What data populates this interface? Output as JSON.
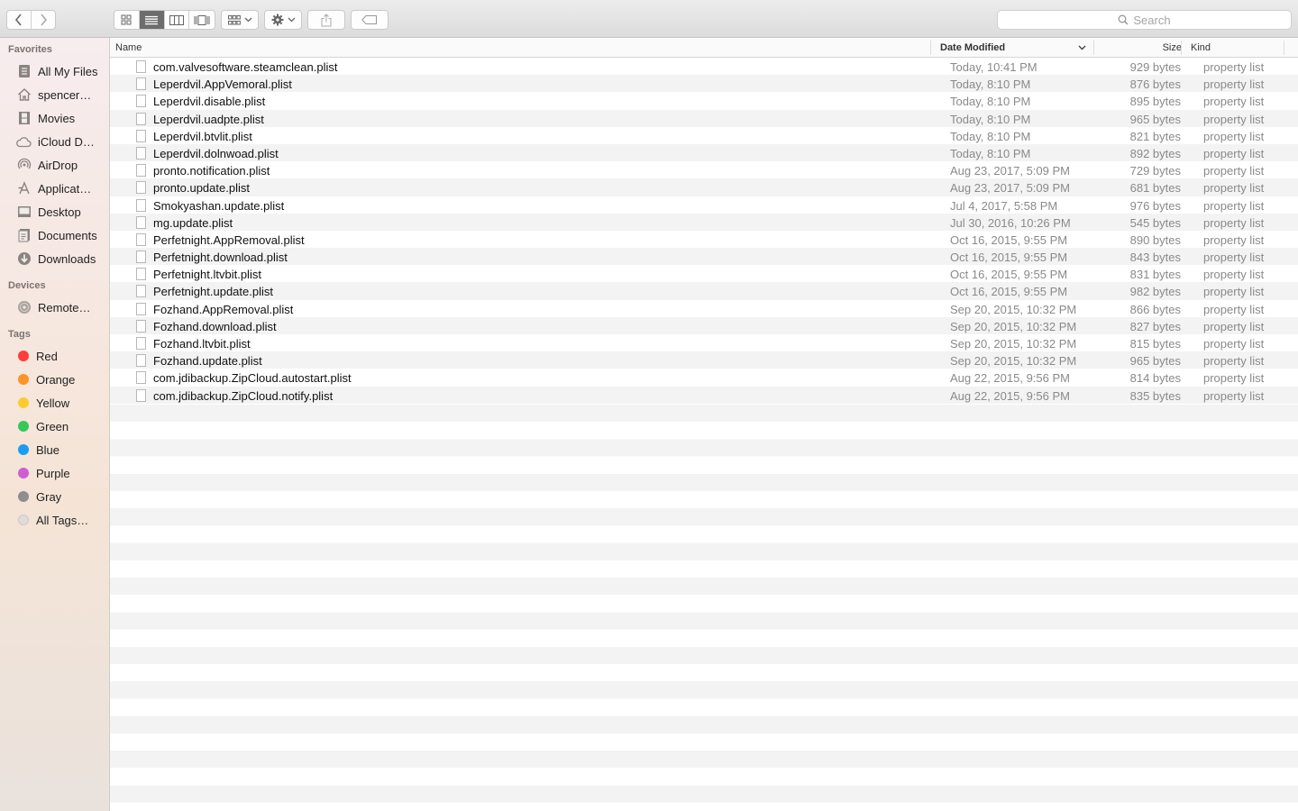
{
  "toolbar": {
    "search_placeholder": "Search",
    "back_icon": "chevron-left-icon",
    "forward_icon": "chevron-right-icon",
    "view_modes": [
      "icon-view-icon",
      "list-view-icon",
      "column-view-icon",
      "coverflow-view-icon"
    ],
    "active_view": "list-view-icon"
  },
  "sidebar": {
    "favorites_header": "Favorites",
    "favorites": [
      {
        "label": "All My Files",
        "icon": "all-files-icon"
      },
      {
        "label": "spencer…",
        "icon": "home-icon"
      },
      {
        "label": "Movies",
        "icon": "movies-icon"
      },
      {
        "label": "iCloud D…",
        "icon": "cloud-icon"
      },
      {
        "label": "AirDrop",
        "icon": "airdrop-icon"
      },
      {
        "label": "Applicat…",
        "icon": "applications-icon"
      },
      {
        "label": "Desktop",
        "icon": "desktop-icon"
      },
      {
        "label": "Documents",
        "icon": "documents-icon"
      },
      {
        "label": "Downloads",
        "icon": "downloads-icon"
      }
    ],
    "devices_header": "Devices",
    "devices": [
      {
        "label": "Remote…",
        "icon": "remote-disc-icon"
      }
    ],
    "tags_header": "Tags",
    "tags": [
      {
        "label": "Red",
        "color": "#fc3d39"
      },
      {
        "label": "Orange",
        "color": "#fd9426"
      },
      {
        "label": "Yellow",
        "color": "#fecb2f"
      },
      {
        "label": "Green",
        "color": "#35c759"
      },
      {
        "label": "Blue",
        "color": "#1a9cf1"
      },
      {
        "label": "Purple",
        "color": "#cc5fd3"
      },
      {
        "label": "Gray",
        "color": "#8e8e8e"
      },
      {
        "label": "All Tags…",
        "color": "#e0dcd8"
      }
    ]
  },
  "columns": {
    "name": "Name",
    "date": "Date Modified",
    "size": "Size",
    "kind": "Kind"
  },
  "files": [
    {
      "name": "com.valvesoftware.steamclean.plist",
      "date": "Today, 10:41 PM",
      "size": "929 bytes",
      "kind": "property list"
    },
    {
      "name": "Leperdvil.AppVemoral.plist",
      "date": "Today, 8:10 PM",
      "size": "876 bytes",
      "kind": "property list"
    },
    {
      "name": "Leperdvil.disable.plist",
      "date": "Today, 8:10 PM",
      "size": "895 bytes",
      "kind": "property list"
    },
    {
      "name": "Leperdvil.uadpte.plist",
      "date": "Today, 8:10 PM",
      "size": "965 bytes",
      "kind": "property list"
    },
    {
      "name": "Leperdvil.btvlit.plist",
      "date": "Today, 8:10 PM",
      "size": "821 bytes",
      "kind": "property list"
    },
    {
      "name": "Leperdvil.dolnwoad.plist",
      "date": "Today, 8:10 PM",
      "size": "892 bytes",
      "kind": "property list"
    },
    {
      "name": "pronto.notification.plist",
      "date": "Aug 23, 2017, 5:09 PM",
      "size": "729 bytes",
      "kind": "property list"
    },
    {
      "name": "pronto.update.plist",
      "date": "Aug 23, 2017, 5:09 PM",
      "size": "681 bytes",
      "kind": "property list"
    },
    {
      "name": "Smokyashan.update.plist",
      "date": "Jul 4, 2017, 5:58 PM",
      "size": "976 bytes",
      "kind": "property list"
    },
    {
      "name": "mg.update.plist",
      "date": "Jul 30, 2016, 10:26 PM",
      "size": "545 bytes",
      "kind": "property list"
    },
    {
      "name": "Perfetnight.AppRemoval.plist",
      "date": "Oct 16, 2015, 9:55 PM",
      "size": "890 bytes",
      "kind": "property list"
    },
    {
      "name": "Perfetnight.download.plist",
      "date": "Oct 16, 2015, 9:55 PM",
      "size": "843 bytes",
      "kind": "property list"
    },
    {
      "name": "Perfetnight.ltvbit.plist",
      "date": "Oct 16, 2015, 9:55 PM",
      "size": "831 bytes",
      "kind": "property list"
    },
    {
      "name": "Perfetnight.update.plist",
      "date": "Oct 16, 2015, 9:55 PM",
      "size": "982 bytes",
      "kind": "property list"
    },
    {
      "name": "Fozhand.AppRemoval.plist",
      "date": "Sep 20, 2015, 10:32 PM",
      "size": "866 bytes",
      "kind": "property list"
    },
    {
      "name": "Fozhand.download.plist",
      "date": "Sep 20, 2015, 10:32 PM",
      "size": "827 bytes",
      "kind": "property list"
    },
    {
      "name": "Fozhand.ltvbit.plist",
      "date": "Sep 20, 2015, 10:32 PM",
      "size": "815 bytes",
      "kind": "property list"
    },
    {
      "name": "Fozhand.update.plist",
      "date": "Sep 20, 2015, 10:32 PM",
      "size": "965 bytes",
      "kind": "property list"
    },
    {
      "name": "com.jdibackup.ZipCloud.autostart.plist",
      "date": "Aug 22, 2015, 9:56 PM",
      "size": "814 bytes",
      "kind": "property list"
    },
    {
      "name": "com.jdibackup.ZipCloud.notify.plist",
      "date": "Aug 22, 2015, 9:56 PM",
      "size": "835 bytes",
      "kind": "property list"
    }
  ]
}
